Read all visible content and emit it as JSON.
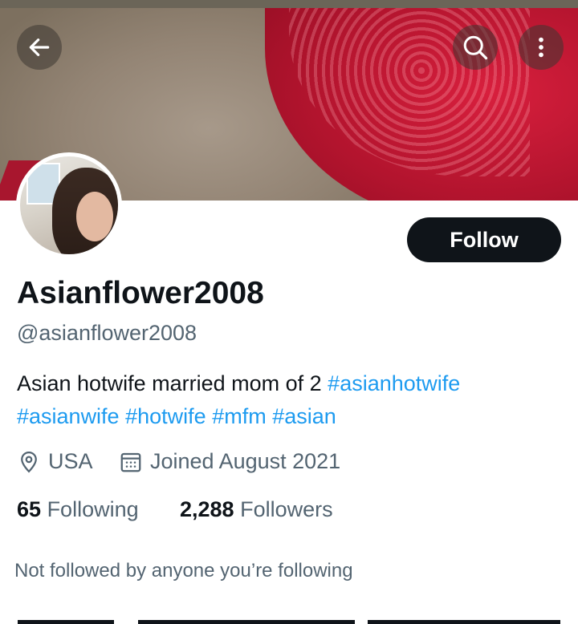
{
  "header": {
    "back_icon": "arrow-left-icon",
    "search_icon": "search-icon",
    "more_icon": "more-vertical-icon"
  },
  "profile": {
    "display_name": "Asianflower2008",
    "handle": "@asianflower2008",
    "follow_label": "Follow",
    "bio": {
      "text": "Asian hotwife married mom of 2",
      "hashtags": [
        "#asianhotwife",
        "#asianwife",
        "#hotwife",
        "#mfm",
        "#asian"
      ]
    },
    "location": "USA",
    "joined": "Joined August 2021",
    "following_count": "65",
    "following_label": "Following",
    "followers_count": "2,288",
    "followers_label": "Followers",
    "not_followed_text": "Not followed by anyone you’re following"
  },
  "colors": {
    "link": "#1d9bf0",
    "secondary_text": "#536471",
    "primary_text": "#0f1419"
  }
}
